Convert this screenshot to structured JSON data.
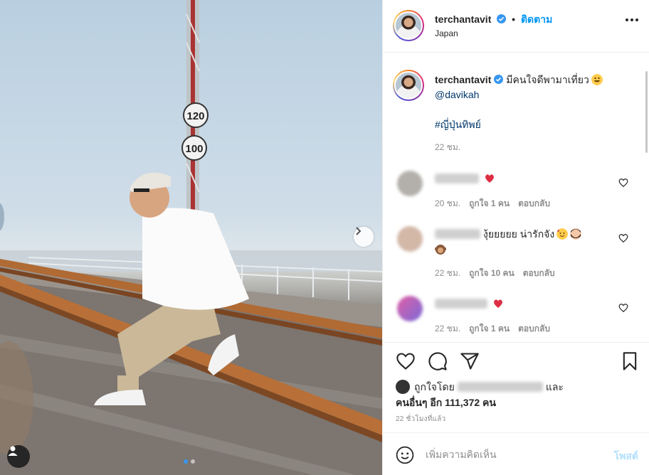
{
  "post": {
    "username": "terchantavit",
    "follow_label": "ติดตาม",
    "location": "Japan",
    "verified_icon": "verified-badge-icon",
    "more_icon": "more-options-icon"
  },
  "caption": {
    "username": "terchantavit",
    "text": "มีคนใจดีพามาเที่ยว",
    "mention": "@davikah",
    "hashtag": "#ญี่ปุ่นทิพย์",
    "time": "22 ชม."
  },
  "comments": [
    {
      "text": "",
      "time": "20 ชม.",
      "likes": "ถูกใจ 1 คน",
      "reply": "ตอบกลับ"
    },
    {
      "text": "งุ้ยยยยย น่ารักจัง",
      "time": "22 ชม.",
      "likes": "ถูกใจ 10 คน",
      "reply": "ตอบกลับ"
    },
    {
      "text": "",
      "time": "22 ชม.",
      "likes": "ถูกใจ 1 คน",
      "reply": "ตอบกลับ"
    }
  ],
  "likes": {
    "prefix": "ถูกใจโดย",
    "suffix": "และ",
    "others": "คนอื่นๆ อีก 111,372 คน"
  },
  "timeago": "22 ชั่วโมงที่แล้ว",
  "comment_box": {
    "placeholder": "เพิ่มความคิดเห็น",
    "post_label": "โพสต์"
  },
  "photo": {
    "signs": [
      "120",
      "100"
    ]
  },
  "colors": {
    "accent": "#0095f6",
    "verified": "#3897f0",
    "heart_red": "#ed4956"
  }
}
